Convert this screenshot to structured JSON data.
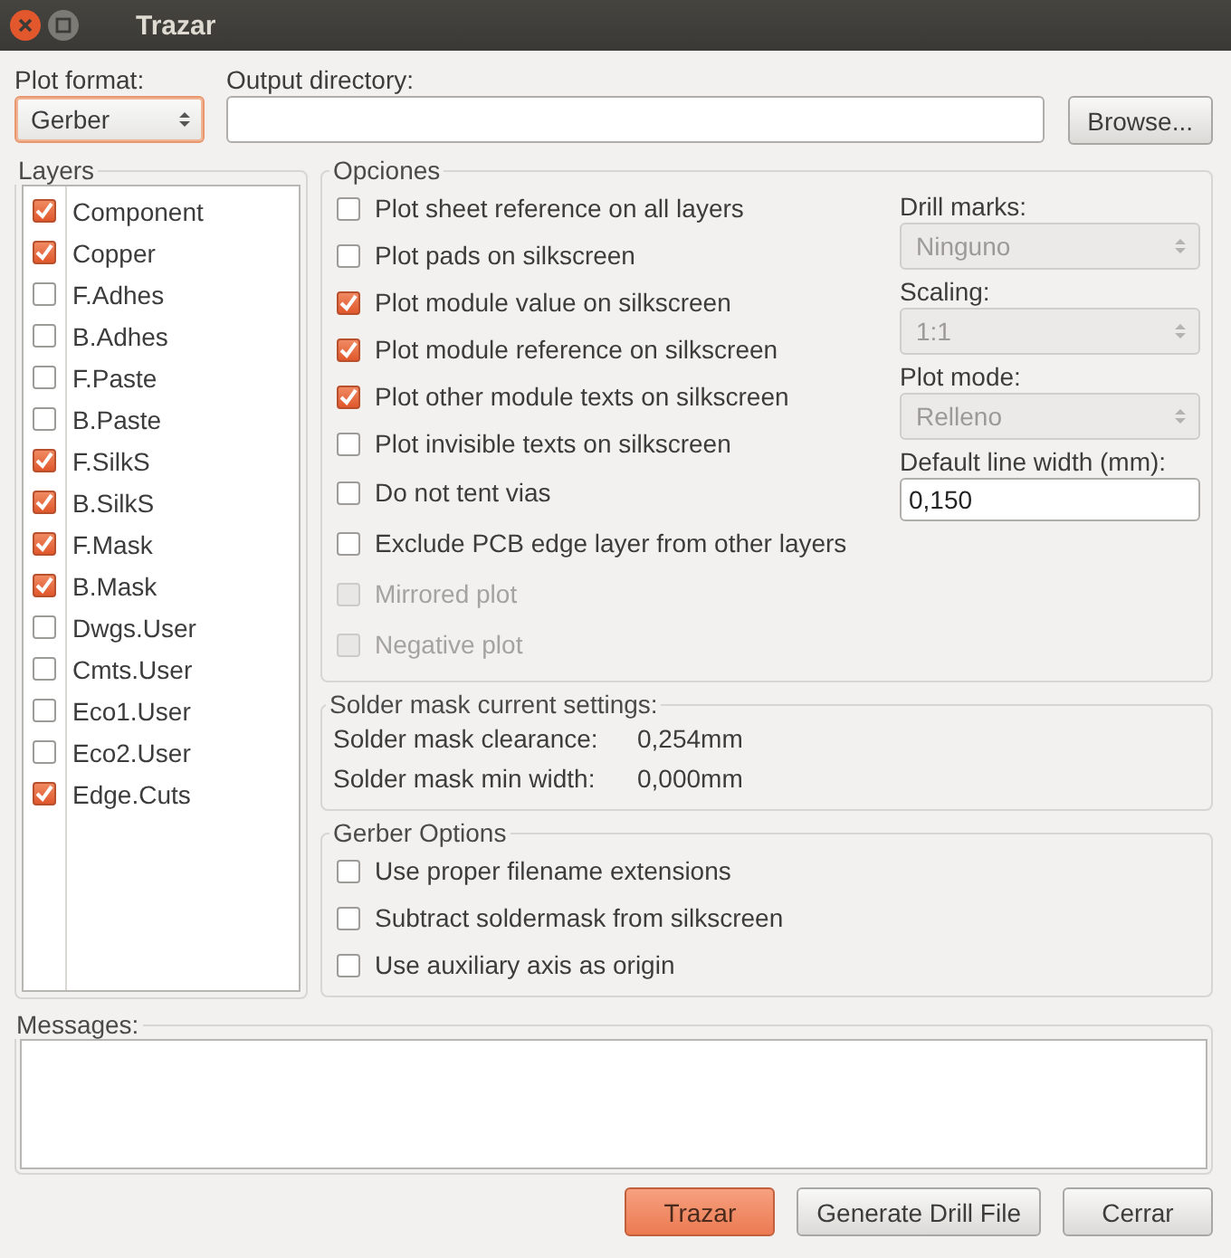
{
  "window": {
    "title": "Trazar"
  },
  "plot_format": {
    "label": "Plot format:",
    "value": "Gerber"
  },
  "output_directory": {
    "label": "Output directory:",
    "button": "Browse..."
  },
  "layers": {
    "title": "Layers",
    "items": [
      {
        "label": "Component",
        "checked": true
      },
      {
        "label": "Copper",
        "checked": true
      },
      {
        "label": "F.Adhes",
        "checked": false
      },
      {
        "label": "B.Adhes",
        "checked": false
      },
      {
        "label": "F.Paste",
        "checked": false
      },
      {
        "label": "B.Paste",
        "checked": false
      },
      {
        "label": "F.SilkS",
        "checked": true
      },
      {
        "label": "B.SilkS",
        "checked": true
      },
      {
        "label": "F.Mask",
        "checked": true
      },
      {
        "label": "B.Mask",
        "checked": true
      },
      {
        "label": "Dwgs.User",
        "checked": false
      },
      {
        "label": "Cmts.User",
        "checked": false
      },
      {
        "label": "Eco1.User",
        "checked": false
      },
      {
        "label": "Eco2.User",
        "checked": false
      },
      {
        "label": "Edge.Cuts",
        "checked": true
      }
    ]
  },
  "options": {
    "title": "Opciones",
    "checkboxes": [
      {
        "label": "Plot sheet reference on all layers",
        "checked": false,
        "disabled": false
      },
      {
        "label": "Plot pads on silkscreen",
        "checked": false,
        "disabled": false
      },
      {
        "label": "Plot module value on silkscreen",
        "checked": true,
        "disabled": false
      },
      {
        "label": "Plot module reference on silkscreen",
        "checked": true,
        "disabled": false
      },
      {
        "label": "Plot other module texts on silkscreen",
        "checked": true,
        "disabled": false
      },
      {
        "label": "Plot invisible texts on silkscreen",
        "checked": false,
        "disabled": false
      },
      {
        "label": "Do not tent vias",
        "checked": false,
        "disabled": false
      },
      {
        "label": "Exclude PCB edge layer from other layers",
        "checked": false,
        "disabled": false
      },
      {
        "label": "Mirrored plot",
        "checked": false,
        "disabled": true
      },
      {
        "label": "Negative plot",
        "checked": false,
        "disabled": true
      }
    ],
    "selects": [
      {
        "label": "Drill marks:",
        "value": "Ninguno",
        "disabled": true
      },
      {
        "label": "Scaling:",
        "value": "1:1",
        "disabled": true
      },
      {
        "label": "Plot mode:",
        "value": "Relleno",
        "disabled": true
      }
    ],
    "line_width": {
      "label": "Default line width (mm):",
      "value": "0,150"
    }
  },
  "solder_mask": {
    "title": "Solder mask current settings:",
    "rows": [
      {
        "label": "Solder mask clearance:",
        "value": "0,254mm"
      },
      {
        "label": "Solder mask min width:",
        "value": "0,000mm"
      }
    ]
  },
  "gerber_options": {
    "title": "Gerber Options",
    "checkboxes": [
      {
        "label": "Use proper filename extensions",
        "checked": false
      },
      {
        "label": "Subtract soldermask from silkscreen",
        "checked": false
      },
      {
        "label": "Use auxiliary axis as origin",
        "checked": false
      }
    ]
  },
  "messages": {
    "title": "Messages:"
  },
  "buttons": [
    {
      "label": "Trazar",
      "kind": "primary"
    },
    {
      "label": "Generate Drill File",
      "kind": "normal"
    },
    {
      "label": "Cerrar",
      "kind": "normal"
    }
  ]
}
